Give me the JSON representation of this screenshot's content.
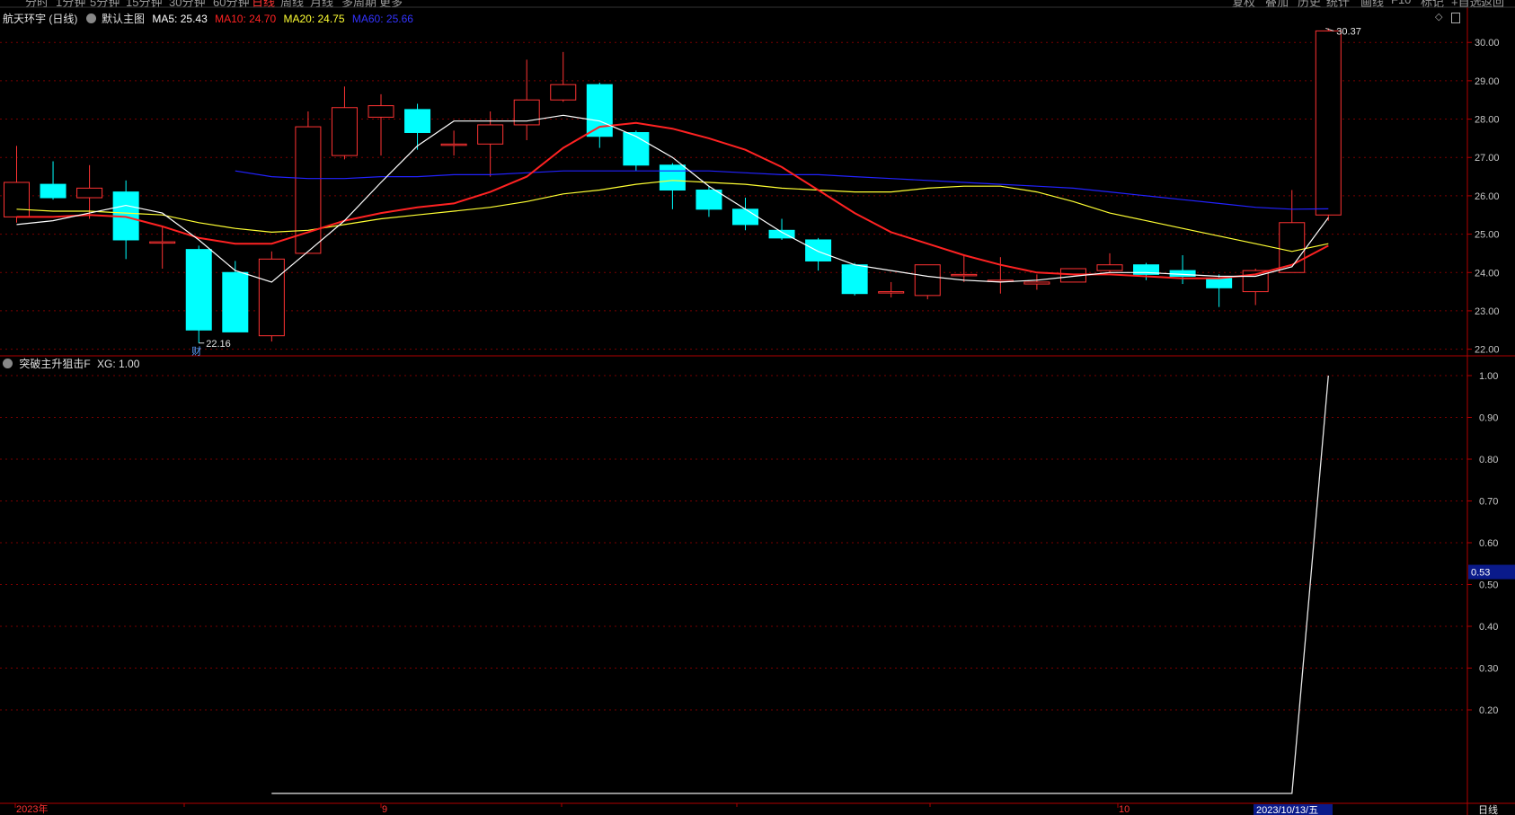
{
  "top_menu": {
    "left": [
      "分时",
      "1分钟",
      "5分钟",
      "15分钟",
      "30分钟",
      "60分钟",
      "日线",
      "周线",
      "月线",
      "多周期",
      "更多"
    ],
    "right": [
      "复权",
      "叠加",
      "历史",
      "统计",
      "画线",
      "F10",
      "标记",
      "+自选",
      "返回"
    ],
    "active": "日线"
  },
  "main_header": {
    "stock": "航天环宇 (日线)",
    "chart_name": "默认主图",
    "ma5": "MA5: 25.43",
    "ma10": "MA10: 24.70",
    "ma20": "MA20: 24.75",
    "ma60": "MA60: 25.66"
  },
  "sub_header": {
    "name": "突破主升狙击F",
    "value": "XG: 1.00"
  },
  "colors": {
    "up": "#ff3333",
    "down": "#00ffff",
    "ma5": "#ffffff",
    "ma10": "#ff2222",
    "ma20": "#ffff33",
    "ma60": "#2222ff",
    "grid": "#7a0000",
    "border": "#b00000"
  },
  "chart_data": [
    {
      "type": "candlestick",
      "yticks": [
        "30.00",
        "29.00",
        "28.00",
        "27.00",
        "26.00",
        "25.00",
        "24.00",
        "23.00",
        "22.00"
      ],
      "ylim": [
        21.85,
        30.45
      ],
      "candles": [
        {
          "o": 25.45,
          "c": 26.35,
          "h": 27.3,
          "l": 25.3
        },
        {
          "o": 26.3,
          "c": 25.95,
          "h": 26.9,
          "l": 25.9
        },
        {
          "o": 25.95,
          "c": 26.2,
          "h": 26.8,
          "l": 25.4
        },
        {
          "o": 26.1,
          "c": 24.85,
          "h": 26.4,
          "l": 24.35
        },
        {
          "o": 24.8,
          "c": 24.8,
          "h": 25.2,
          "l": 24.1
        },
        {
          "o": 24.6,
          "c": 22.5,
          "h": 24.7,
          "l": 22.16
        },
        {
          "o": 24.0,
          "c": 22.45,
          "h": 24.3,
          "l": 22.45
        },
        {
          "o": 22.35,
          "c": 24.35,
          "h": 24.55,
          "l": 22.2
        },
        {
          "o": 24.5,
          "c": 27.8,
          "h": 28.2,
          "l": 24.5
        },
        {
          "o": 27.05,
          "c": 28.3,
          "h": 28.85,
          "l": 26.95
        },
        {
          "o": 28.05,
          "c": 28.35,
          "h": 28.65,
          "l": 27.05
        },
        {
          "o": 28.25,
          "c": 27.65,
          "h": 28.4,
          "l": 27.2
        },
        {
          "o": 27.35,
          "c": 27.35,
          "h": 27.7,
          "l": 27.05
        },
        {
          "o": 27.35,
          "c": 27.85,
          "h": 28.2,
          "l": 26.5
        },
        {
          "o": 27.85,
          "c": 28.5,
          "h": 29.55,
          "l": 27.45
        },
        {
          "o": 28.5,
          "c": 28.9,
          "h": 29.75,
          "l": 28.45
        },
        {
          "o": 28.9,
          "c": 27.55,
          "h": 28.95,
          "l": 27.25
        },
        {
          "o": 27.65,
          "c": 26.8,
          "h": 27.7,
          "l": 26.65
        },
        {
          "o": 26.8,
          "c": 26.15,
          "h": 26.85,
          "l": 25.65
        },
        {
          "o": 26.15,
          "c": 25.65,
          "h": 26.25,
          "l": 25.45
        },
        {
          "o": 25.65,
          "c": 25.25,
          "h": 25.95,
          "l": 25.1
        },
        {
          "o": 25.1,
          "c": 24.9,
          "h": 25.4,
          "l": 24.85
        },
        {
          "o": 24.85,
          "c": 24.3,
          "h": 24.9,
          "l": 24.05
        },
        {
          "o": 24.2,
          "c": 23.45,
          "h": 24.25,
          "l": 23.4
        },
        {
          "o": 23.5,
          "c": 23.5,
          "h": 23.75,
          "l": 23.35
        },
        {
          "o": 23.4,
          "c": 24.2,
          "h": 24.2,
          "l": 23.3
        },
        {
          "o": 23.95,
          "c": 23.95,
          "h": 24.45,
          "l": 23.75
        },
        {
          "o": 23.8,
          "c": 23.8,
          "h": 24.4,
          "l": 23.45
        },
        {
          "o": 23.7,
          "c": 23.75,
          "h": 23.95,
          "l": 23.55
        },
        {
          "o": 23.75,
          "c": 24.1,
          "h": 24.1,
          "l": 23.75
        },
        {
          "o": 24.05,
          "c": 24.2,
          "h": 24.5,
          "l": 24.0
        },
        {
          "o": 24.2,
          "c": 23.95,
          "h": 24.25,
          "l": 23.8
        },
        {
          "o": 24.05,
          "c": 23.9,
          "h": 24.45,
          "l": 23.7
        },
        {
          "o": 23.85,
          "c": 23.6,
          "h": 23.95,
          "l": 23.1
        },
        {
          "o": 23.5,
          "c": 24.05,
          "h": 24.1,
          "l": 23.15
        },
        {
          "o": 24.0,
          "c": 25.3,
          "h": 26.15,
          "l": 24.0
        },
        {
          "o": 25.5,
          "c": 30.3,
          "h": 30.37,
          "l": 25.35
        }
      ],
      "ma5": [
        25.25,
        25.35,
        25.55,
        25.75,
        25.55,
        24.85,
        24.05,
        23.75,
        24.55,
        25.35,
        26.35,
        27.3,
        27.95,
        27.95,
        27.95,
        28.1,
        27.95,
        27.55,
        27.0,
        26.25,
        25.65,
        25.05,
        24.55,
        24.2,
        24.05,
        23.9,
        23.8,
        23.75,
        23.8,
        23.9,
        24.0,
        24.0,
        23.95,
        23.9,
        23.9,
        24.15,
        25.43
      ],
      "ma10": [
        25.45,
        25.45,
        25.5,
        25.45,
        25.2,
        24.9,
        24.75,
        24.75,
        25.05,
        25.35,
        25.55,
        25.7,
        25.8,
        26.1,
        26.5,
        27.25,
        27.8,
        27.9,
        27.75,
        27.5,
        27.2,
        26.75,
        26.15,
        25.55,
        25.05,
        24.75,
        24.45,
        24.2,
        24.0,
        23.95,
        23.95,
        23.9,
        23.85,
        23.85,
        23.95,
        24.2,
        24.7
      ],
      "ma20": [
        25.65,
        25.6,
        25.6,
        25.55,
        25.5,
        25.3,
        25.15,
        25.05,
        25.1,
        25.25,
        25.4,
        25.5,
        25.6,
        25.7,
        25.85,
        26.05,
        26.15,
        26.3,
        26.4,
        26.35,
        26.3,
        26.2,
        26.15,
        26.1,
        26.1,
        26.2,
        26.25,
        26.25,
        26.1,
        25.85,
        25.55,
        25.35,
        25.15,
        24.95,
        24.75,
        24.55,
        24.75
      ],
      "ma60": [
        null,
        null,
        null,
        null,
        null,
        null,
        26.65,
        26.5,
        26.45,
        26.45,
        26.5,
        26.5,
        26.55,
        26.55,
        26.6,
        26.65,
        26.65,
        26.65,
        26.65,
        26.65,
        26.6,
        26.55,
        26.55,
        26.5,
        26.45,
        26.4,
        26.35,
        26.3,
        26.25,
        26.2,
        26.1,
        26.0,
        25.9,
        25.8,
        25.7,
        25.65,
        25.66
      ],
      "max_label": "30.37",
      "min_label": "22.16",
      "marker": "财"
    },
    {
      "type": "line",
      "name": "XG",
      "yticks": [
        "1.00",
        "0.90",
        "0.80",
        "0.70",
        "0.60",
        "0.50",
        "0.40",
        "0.30",
        "0.20"
      ],
      "ylim": [
        0,
        1
      ],
      "values": [
        0,
        0,
        0,
        0,
        0,
        0,
        0,
        0,
        0,
        0,
        0,
        0,
        0,
        0,
        0,
        0,
        0,
        0,
        0,
        0,
        0,
        0,
        0,
        0,
        0,
        0,
        0,
        0,
        0,
        0,
        0,
        0,
        0,
        0,
        0,
        0,
        1
      ],
      "line_start_index": 7,
      "current_label": "0.53"
    }
  ],
  "x_axis": {
    "labels": [
      "2023年",
      "9",
      "10"
    ],
    "cursor_date": "2023/10/13/五",
    "period": "日线"
  }
}
